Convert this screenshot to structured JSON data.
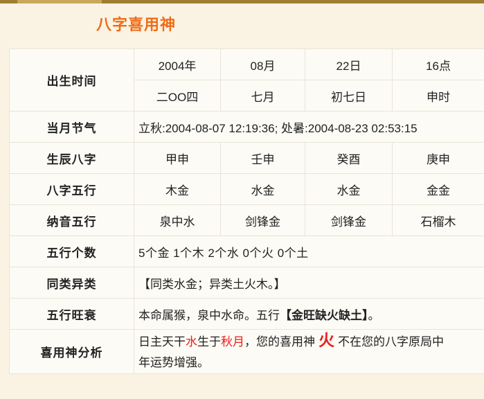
{
  "title": "八字喜用神",
  "accent_color": "#f06c16",
  "highlight_color": "#e8201c",
  "table": {
    "rows": {
      "birth_time": {
        "label": "出生时间",
        "solar": [
          "2004年",
          "08月",
          "22日",
          "16点"
        ],
        "lunar": [
          "二OO四",
          "七月",
          "初七日",
          "申时"
        ]
      },
      "solar_terms": {
        "label": "当月节气",
        "value": "立秋:2004-08-07 12:19:36; 处暑:2004-08-23 02:53:15"
      },
      "bazi": {
        "label": "生辰八字",
        "values": [
          "甲申",
          "壬申",
          "癸酉",
          "庚申"
        ]
      },
      "bazi_wuxing": {
        "label": "八字五行",
        "values": [
          "木金",
          "水金",
          "水金",
          "金金"
        ]
      },
      "nayin_wuxing": {
        "label": "纳音五行",
        "values": [
          "泉中水",
          "剑锋金",
          "剑锋金",
          "石榴木"
        ]
      },
      "wuxing_count": {
        "label": "五行个数",
        "value": "5个金  1个木  2个水  0个火  0个土"
      },
      "same_diff": {
        "label": "同类异类",
        "value": "【同类水金；异类土火木。】"
      },
      "wuxing_strength": {
        "label": "五行旺衰",
        "prefix": "本命属猴，泉中水命。五行",
        "bracket": "【金旺缺火缺土】",
        "suffix": "。"
      },
      "analysis": {
        "label": "喜用神分析",
        "line1_a": "日主天干",
        "line1_red1": "水",
        "line1_b": "生于",
        "line1_red2": "秋月",
        "line1_c": "，您的喜用神",
        "line1_bigred": "火",
        "line1_d": "不在您的八字原局中",
        "line2": "年运势增强。"
      }
    }
  }
}
